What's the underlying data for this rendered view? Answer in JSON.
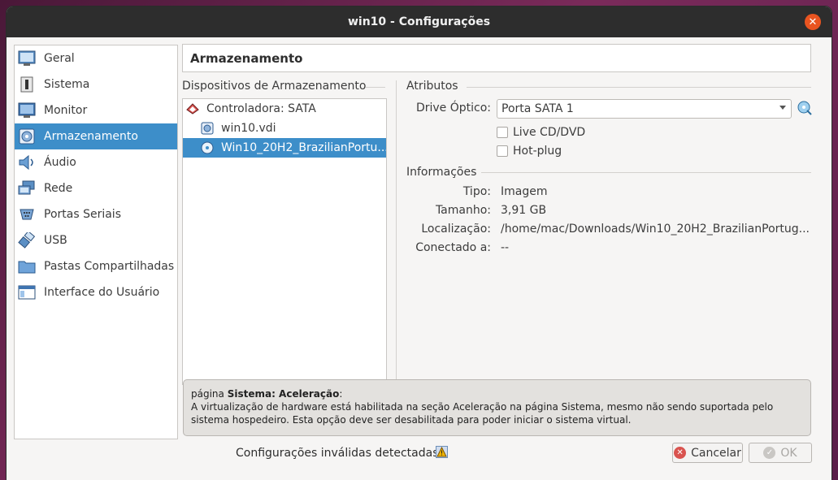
{
  "window": {
    "title": "win10 - Configurações",
    "close_glyph": "✕"
  },
  "sidebar": {
    "items": [
      {
        "label": "Geral",
        "icon": "monitor-icon"
      },
      {
        "label": "Sistema",
        "icon": "chip-icon"
      },
      {
        "label": "Monitor",
        "icon": "display-icon"
      },
      {
        "label": "Armazenamento",
        "icon": "disk-icon",
        "selected": true
      },
      {
        "label": "Áudio",
        "icon": "speaker-icon"
      },
      {
        "label": "Rede",
        "icon": "network-icon"
      },
      {
        "label": "Portas Seriais",
        "icon": "serial-port-icon"
      },
      {
        "label": "USB",
        "icon": "usb-icon"
      },
      {
        "label": "Pastas Compartilhadas",
        "icon": "folder-icon"
      },
      {
        "label": "Interface do Usuário",
        "icon": "window-icon"
      }
    ]
  },
  "page": {
    "title": "Armazenamento"
  },
  "storage": {
    "group_title": "Dispositivos de Armazenamento",
    "tree": [
      {
        "label": "Controladora: SATA",
        "icon": "controller-icon"
      },
      {
        "label": "win10.vdi",
        "icon": "hard-disk-icon"
      },
      {
        "label": "Win10_20H2_BrazilianPortu...",
        "icon": "optical-disc-icon",
        "selected": true
      }
    ]
  },
  "attributes": {
    "group_title": "Atributos",
    "drive_label": "Drive Óptico:",
    "drive_value": "Porta SATA 1",
    "live_cd": "Live CD/DVD",
    "hot_plug": "Hot-plug"
  },
  "info": {
    "group_title": "Informações",
    "type_label": "Tipo:",
    "type_value": "Imagem",
    "size_label": "Tamanho:",
    "size_value": "3,91 GB",
    "location_label": "Localização:",
    "location_value": "/home/mac/Downloads/Win10_20H2_BrazilianPortug...",
    "connected_label": "Conectado a:",
    "connected_value": "--"
  },
  "warning": {
    "prefix": "página ",
    "strong": "Sistema: Aceleração",
    "suffix": ":",
    "body": "A virtualização de hardware está habilitada na seção Aceleração na página Sistema, mesmo não sendo suportada pelo sistema hospedeiro. Esta opção deve ser desabilitada para poder iniciar o sistema virtual."
  },
  "footer": {
    "status": "Configurações inválidas detectadas",
    "cancel": "Cancelar",
    "ok": "OK"
  },
  "colors": {
    "accent": "#3d8ec9",
    "titlebar": "#2d2d2d",
    "close": "#e95420"
  }
}
